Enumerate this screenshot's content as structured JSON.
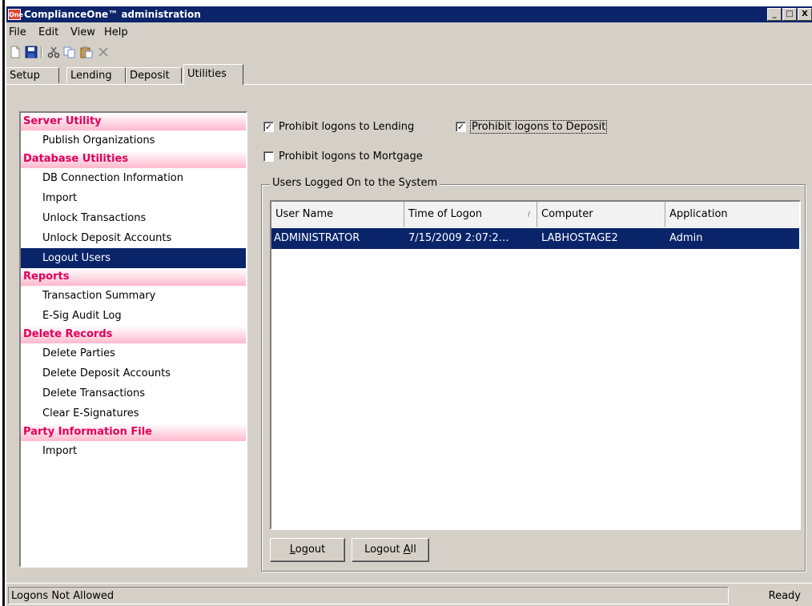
{
  "window": {
    "icon_text": "One",
    "title": "ComplianceOne™ administration",
    "btn_min": "_",
    "btn_max": "□",
    "btn_close": "X"
  },
  "menu": {
    "file": "File",
    "edit": "Edit",
    "view": "View",
    "help": "Help"
  },
  "toolbar": {
    "icons": [
      "new-document-icon",
      "save-icon",
      "cut-icon",
      "copy-icon",
      "paste-icon",
      "delete-icon"
    ]
  },
  "tabs": [
    {
      "label": "Setup"
    },
    {
      "label": "Lending"
    },
    {
      "label": "Deposit"
    },
    {
      "label": "Utilities",
      "active": true
    }
  ],
  "tree": {
    "groups": [
      {
        "label": "Server Utility",
        "items": [
          "Publish Organizations"
        ]
      },
      {
        "label": "Database Utilities",
        "items": [
          "DB Connection Information",
          "Import",
          "Unlock Transactions",
          "Unlock Deposit Accounts",
          "Logout Users"
        ]
      },
      {
        "label": "Reports",
        "items": [
          "Transaction Summary",
          "E-Sig Audit Log"
        ]
      },
      {
        "label": "Delete Records",
        "items": [
          "Delete Parties",
          "Delete Deposit Accounts",
          "Delete Transactions",
          "Clear E-Signatures"
        ]
      },
      {
        "label": "Party Information File",
        "items": [
          "Import"
        ]
      }
    ],
    "selected": "Logout Users"
  },
  "options": {
    "prohibit_lending": {
      "label": "Prohibit logons to Lending",
      "checked": true,
      "mark": "✓"
    },
    "prohibit_deposit": {
      "label": "Prohibit logons to Deposit",
      "checked": true,
      "mark": "✓"
    },
    "prohibit_mortgage": {
      "label": "Prohibit logons to Mortgage",
      "checked": false,
      "mark": ""
    }
  },
  "users_group": {
    "label": "Users Logged On to the System",
    "columns": [
      "User Name",
      "Time of Logon",
      "Computer",
      "Application"
    ],
    "sort_indicator": "/",
    "rows": [
      {
        "user": "ADMINISTRATOR",
        "time": "7/15/2009 2:07:2…",
        "computer": "LABHOSTAGE2",
        "application": "Admin"
      }
    ]
  },
  "buttons": {
    "logout_pre": "",
    "logout_u": "L",
    "logout_post": "ogout",
    "logout_all_pre": "Logout ",
    "logout_all_u": "A",
    "logout_all_post": "ll"
  },
  "status": {
    "left": "Logons Not Allowed",
    "right": "Ready"
  }
}
